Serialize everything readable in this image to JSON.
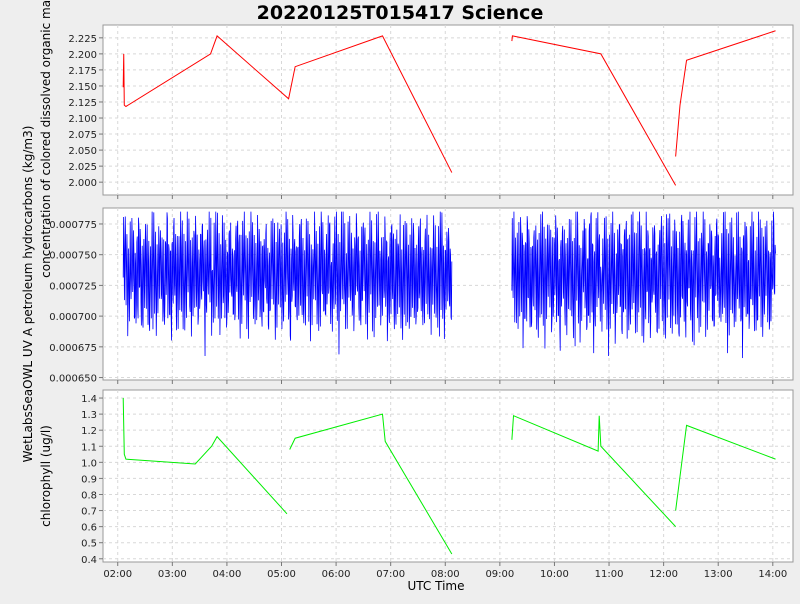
{
  "chart_data": {
    "title": "20220125T015417 Science",
    "xlabel": "UTC Time",
    "x_ticks": [
      "02:00",
      "03:00",
      "04:00",
      "05:00",
      "06:00",
      "07:00",
      "08:00",
      "09:00",
      "10:00",
      "11:00",
      "12:00",
      "13:00",
      "14:00"
    ],
    "x_range_hours": [
      1.73,
      14.37
    ],
    "panels": [
      {
        "type": "line",
        "ylabel": "concentration of colored dissolved organic matter (ppb)",
        "color": "#ff0000",
        "ylim": [
          1.98,
          2.245
        ],
        "y_ticks": [
          "2.000",
          "2.025",
          "2.050",
          "2.075",
          "2.100",
          "2.125",
          "2.150",
          "2.175",
          "2.200",
          "2.225"
        ],
        "y_tick_values": [
          2.0,
          2.025,
          2.05,
          2.075,
          2.1,
          2.125,
          2.15,
          2.175,
          2.2,
          2.225
        ],
        "segments": [
          [
            [
              2.1,
              2.148
            ],
            [
              2.11,
              2.2
            ],
            [
              2.12,
              2.12
            ],
            [
              2.15,
              2.118
            ],
            [
              3.7,
              2.2
            ],
            [
              3.82,
              2.228
            ],
            [
              5.13,
              2.13
            ],
            [
              5.25,
              2.18
            ],
            [
              6.85,
              2.228
            ],
            [
              8.12,
              2.015
            ]
          ],
          [
            [
              9.22,
              2.22
            ],
            [
              9.23,
              2.228
            ],
            [
              10.85,
              2.2
            ],
            [
              12.22,
              1.995
            ]
          ],
          [
            [
              12.22,
              2.04
            ],
            [
              12.3,
              2.12
            ],
            [
              12.42,
              2.19
            ],
            [
              14.05,
              2.236
            ]
          ]
        ]
      },
      {
        "type": "line",
        "ylabel": "WetLabsSeaOWL UV A petroleum hydrocarbons (kg/m3)",
        "color": "#0000ff",
        "ylim": [
          0.000648,
          0.000788
        ],
        "y_ticks": [
          "0.000650",
          "0.000675",
          "0.000700",
          "0.000725",
          "0.000750",
          "0.000775"
        ],
        "y_tick_values": [
          0.00065,
          0.000675,
          0.0007,
          0.000725,
          0.00075,
          0.000775
        ],
        "segments": [
          {
            "start": 2.1,
            "end": 8.12,
            "base": 0.000736,
            "amp": 4.2e-05,
            "noise": 8e-06
          },
          {
            "start": 9.22,
            "end": 14.05,
            "base": 0.000735,
            "amp": 4.4e-05,
            "noise": 9e-06
          }
        ]
      },
      {
        "type": "line",
        "ylabel": "chlorophyll (ug/l)",
        "color": "#00ee00",
        "ylim": [
          0.38,
          1.45
        ],
        "y_ticks": [
          "0.4",
          "0.5",
          "0.6",
          "0.7",
          "0.8",
          "0.9",
          "1.0",
          "1.1",
          "1.2",
          "1.3",
          "1.4"
        ],
        "y_tick_values": [
          0.4,
          0.5,
          0.6,
          0.7,
          0.8,
          0.9,
          1.0,
          1.1,
          1.2,
          1.3,
          1.4
        ],
        "segments": [
          [
            [
              2.1,
              1.4
            ],
            [
              2.12,
              1.05
            ],
            [
              2.15,
              1.02
            ],
            [
              3.42,
              0.99
            ],
            [
              3.72,
              1.1
            ],
            [
              3.82,
              1.16
            ],
            [
              5.1,
              0.68
            ]
          ],
          [
            [
              5.15,
              1.08
            ],
            [
              5.25,
              1.15
            ],
            [
              6.85,
              1.3
            ],
            [
              6.9,
              1.13
            ],
            [
              8.12,
              0.43
            ]
          ],
          [
            [
              9.22,
              1.14
            ],
            [
              9.25,
              1.29
            ],
            [
              10.8,
              1.07
            ],
            [
              10.82,
              1.29
            ],
            [
              10.85,
              1.1
            ],
            [
              12.22,
              0.6
            ]
          ],
          [
            [
              12.22,
              0.7
            ],
            [
              12.42,
              1.23
            ],
            [
              14.05,
              1.02
            ]
          ]
        ]
      }
    ],
    "left_label_fragment": "WetLabsSeaOWL UV A"
  }
}
